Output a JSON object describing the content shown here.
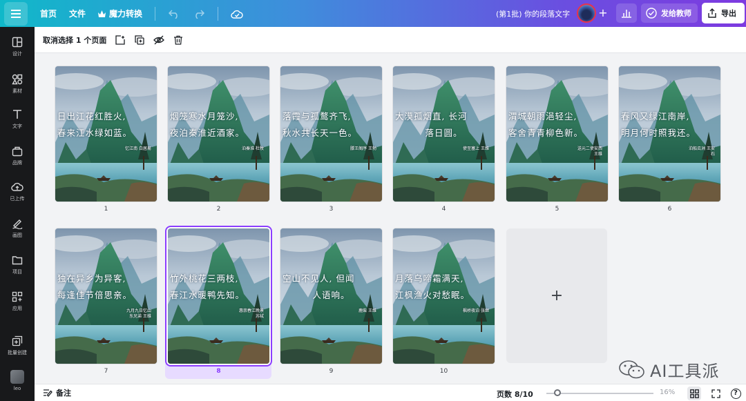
{
  "topbar": {
    "home": "首页",
    "file": "文件",
    "magic": "魔力转换",
    "doc_title": "(第1批) 你的段落文字",
    "plus": "+",
    "send_label": "发给教师",
    "export_label": "导出"
  },
  "sidebar": {
    "items": [
      {
        "label": "设计",
        "icon": "layout-icon"
      },
      {
        "label": "素材",
        "icon": "elements-icon"
      },
      {
        "label": "文字",
        "icon": "text-icon"
      },
      {
        "label": "品牌",
        "icon": "brand-icon"
      },
      {
        "label": "已上传",
        "icon": "upload-icon"
      },
      {
        "label": "画图",
        "icon": "draw-icon"
      },
      {
        "label": "项目",
        "icon": "folder-icon"
      },
      {
        "label": "应用",
        "icon": "apps-icon"
      },
      {
        "label": "批量创建",
        "icon": "bulk-create-icon"
      },
      {
        "label": "leo",
        "icon": "user-avatar"
      }
    ]
  },
  "toolbar": {
    "selection_label": "取消选择 1 个页面"
  },
  "pages": [
    {
      "number": "1",
      "line1": "日出江花红胜火,",
      "line2": "春来江水绿如蓝。",
      "attrib": "忆江南 白居易"
    },
    {
      "number": "2",
      "line1": "烟笼寒水月笼沙,",
      "line2": "夜泊秦淮近酒家。",
      "attrib": "泊秦淮 杜牧"
    },
    {
      "number": "3",
      "line1": "落霞与孤鹜齐飞,",
      "line2": "秋水共长天一色。",
      "attrib": "滕王阁序 王勃"
    },
    {
      "number": "4",
      "line1": "大漠孤烟直, 长河",
      "line2": "落日圆。",
      "attrib": "使至塞上 王维"
    },
    {
      "number": "5",
      "line1": "渭城朝雨浥轻尘,",
      "line2": "客舍青青柳色新。",
      "attrib": "送元二使安西 王维"
    },
    {
      "number": "6",
      "line1": "春风又绿江南岸,",
      "line2": "明月何时照我还。",
      "attrib": "泊船瓜洲 王安石"
    },
    {
      "number": "7",
      "line1": "独在异乡为异客,",
      "line2": "每逢佳节倍思亲。",
      "attrib": "九月九日忆山东兄弟 王维"
    },
    {
      "number": "8",
      "line1": "竹外桃花三两枝,",
      "line2": "春江水暖鸭先知。",
      "attrib": "惠崇春江晚景 苏轼"
    },
    {
      "number": "9",
      "line1": "空山不见人, 但闻",
      "line2": "人语响。",
      "attrib": "鹿柴 王维"
    },
    {
      "number": "10",
      "line1": "月落乌啼霜满天,",
      "line2": "江枫渔火对愁眠。",
      "attrib": "枫桥夜泊 张继"
    }
  ],
  "selected_page": "8",
  "add_page_symbol": "+",
  "bottombar": {
    "notes_label": "备注",
    "page_count": "页数 8/10",
    "zoom": "16%",
    "help": "?"
  },
  "watermark": "AI工具派",
  "colors": {
    "accent": "#8b3dff",
    "topbar_gradient_start": "#10b8c9",
    "topbar_gradient_end": "#7d3ae0",
    "sidebar_bg": "#18191b"
  }
}
